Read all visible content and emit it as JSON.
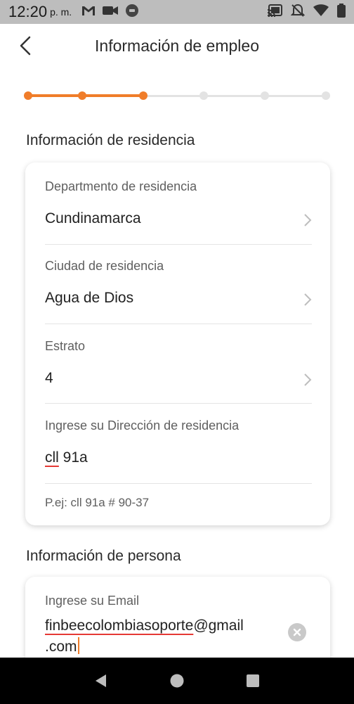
{
  "status": {
    "time": "12:20",
    "ampm": "p. m.",
    "icons_left": [
      "gmail-icon",
      "video-icon",
      "record-icon"
    ],
    "icons_right": [
      "cast-icon",
      "mute-bell-icon",
      "wifi-icon",
      "battery-icon"
    ]
  },
  "header": {
    "title": "Información de empleo"
  },
  "stepper": {
    "total_steps": 6,
    "completed_steps": 3,
    "accent": "#f07d2a"
  },
  "residence": {
    "section_title": "Información de residencia",
    "department": {
      "label": "Departmento de residencia",
      "value": "Cundinamarca"
    },
    "city": {
      "label": "Ciudad de residencia",
      "value": "Agua de Dios"
    },
    "stratum": {
      "label": "Estrato",
      "value": "4"
    },
    "address": {
      "label": "Ingrese su Dirección de residencia",
      "value_word1": "cll",
      "value_rest": " 91a",
      "hint": "P.ej: cll 91a # 90-37"
    }
  },
  "person": {
    "section_title": "Información de persona",
    "email": {
      "label": "Ingrese su Email",
      "value_user": "finbeecolombiasoporte",
      "value_domain": "@gmail",
      "value_tld": ".com"
    }
  }
}
